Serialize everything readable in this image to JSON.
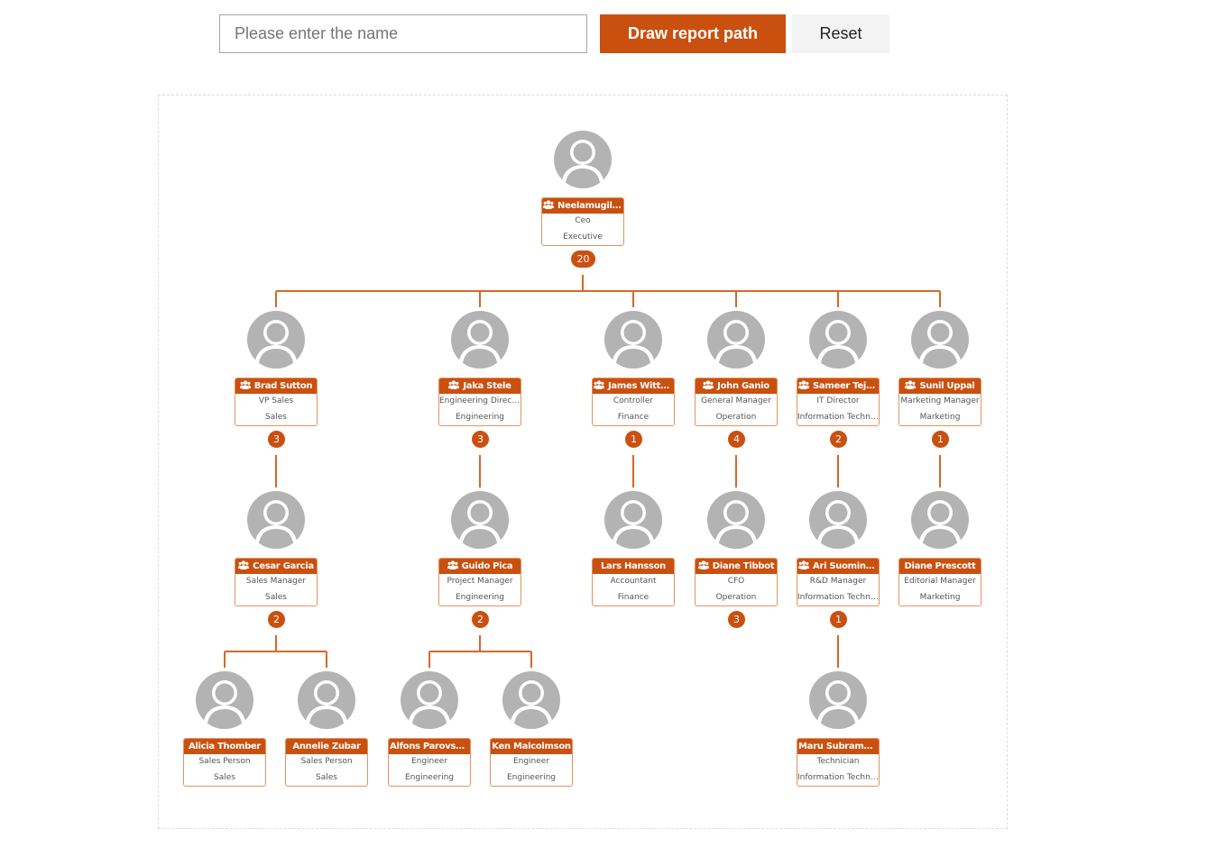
{
  "toolbar": {
    "search_placeholder": "Please enter the name",
    "search_value": "",
    "draw_button_label": "Draw report path",
    "reset_button_label": "Reset"
  },
  "colors": {
    "accent": "#ca5010",
    "card_border": "#e5935f",
    "connector": "#d8672a",
    "avatar": "#b3b3b3",
    "button_secondary": "#f3f3f3"
  },
  "icons": {
    "node_header_icon": "team-icon",
    "avatar_icon": "person-placeholder-icon"
  },
  "org": {
    "nodes": [
      {
        "id": "n0",
        "name": "Neelamugilan...",
        "title": "Ceo",
        "department": "Executive",
        "reports": "20",
        "team_icon": true,
        "parent": null
      },
      {
        "id": "n1",
        "name": "Brad Sutton",
        "title": "VP Sales",
        "department": "Sales",
        "reports": "3",
        "team_icon": true,
        "parent": "n0"
      },
      {
        "id": "n2",
        "name": "Jaka Stele",
        "title": "Engineering Director",
        "department": "Engineering",
        "reports": "3",
        "team_icon": true,
        "parent": "n0"
      },
      {
        "id": "n3",
        "name": "James Wittrell",
        "title": "Controller",
        "department": "Finance",
        "reports": "1",
        "team_icon": true,
        "parent": "n0"
      },
      {
        "id": "n4",
        "name": "John Ganio",
        "title": "General Manager",
        "department": "Operation",
        "reports": "4",
        "team_icon": true,
        "parent": "n0"
      },
      {
        "id": "n5",
        "name": "Sameer Tejani",
        "title": "IT Director",
        "department": "Information Techno...",
        "reports": "2",
        "team_icon": true,
        "parent": "n0"
      },
      {
        "id": "n6",
        "name": "Sunil Uppal",
        "title": "Marketing Manager",
        "department": "Marketing",
        "reports": "1",
        "team_icon": true,
        "parent": "n0"
      },
      {
        "id": "n7",
        "name": "Cesar Garcia",
        "title": "Sales Manager",
        "department": "Sales",
        "reports": "2",
        "team_icon": true,
        "parent": "n1"
      },
      {
        "id": "n8",
        "name": "Guido Pica",
        "title": "Project Manager",
        "department": "Engineering",
        "reports": "2",
        "team_icon": true,
        "parent": "n2"
      },
      {
        "id": "n9",
        "name": "Lars Hansson",
        "title": "Accountant",
        "department": "Finance",
        "reports": null,
        "team_icon": false,
        "parent": "n3"
      },
      {
        "id": "n10",
        "name": "Diane Tibbot",
        "title": "CFO",
        "department": "Operation",
        "reports": "3",
        "team_icon": true,
        "parent": "n4"
      },
      {
        "id": "n11",
        "name": "Ari Suominen",
        "title": "R&D Manager",
        "department": "Information Techno...",
        "reports": "1",
        "team_icon": true,
        "parent": "n5"
      },
      {
        "id": "n12",
        "name": "Diane Prescott",
        "title": "Editorial Manager",
        "department": "Marketing",
        "reports": null,
        "team_icon": false,
        "parent": "n6"
      },
      {
        "id": "n13",
        "name": "Alicia Thomber",
        "title": "Sales Person",
        "department": "Sales",
        "reports": null,
        "team_icon": false,
        "parent": "n7"
      },
      {
        "id": "n14",
        "name": "Annelie Zubar",
        "title": "Sales Person",
        "department": "Sales",
        "reports": null,
        "team_icon": false,
        "parent": "n7"
      },
      {
        "id": "n15",
        "name": "Alfons Parovszky",
        "title": "Engineer",
        "department": "Engineering",
        "reports": null,
        "team_icon": false,
        "parent": "n8"
      },
      {
        "id": "n16",
        "name": "Ken Malcolmson",
        "title": "Engineer",
        "department": "Engineering",
        "reports": null,
        "team_icon": false,
        "parent": "n8"
      },
      {
        "id": "n17",
        "name": "Maru Subramani",
        "title": "Technician",
        "department": "Information Techno...",
        "reports": null,
        "team_icon": false,
        "parent": "n11"
      }
    ]
  }
}
